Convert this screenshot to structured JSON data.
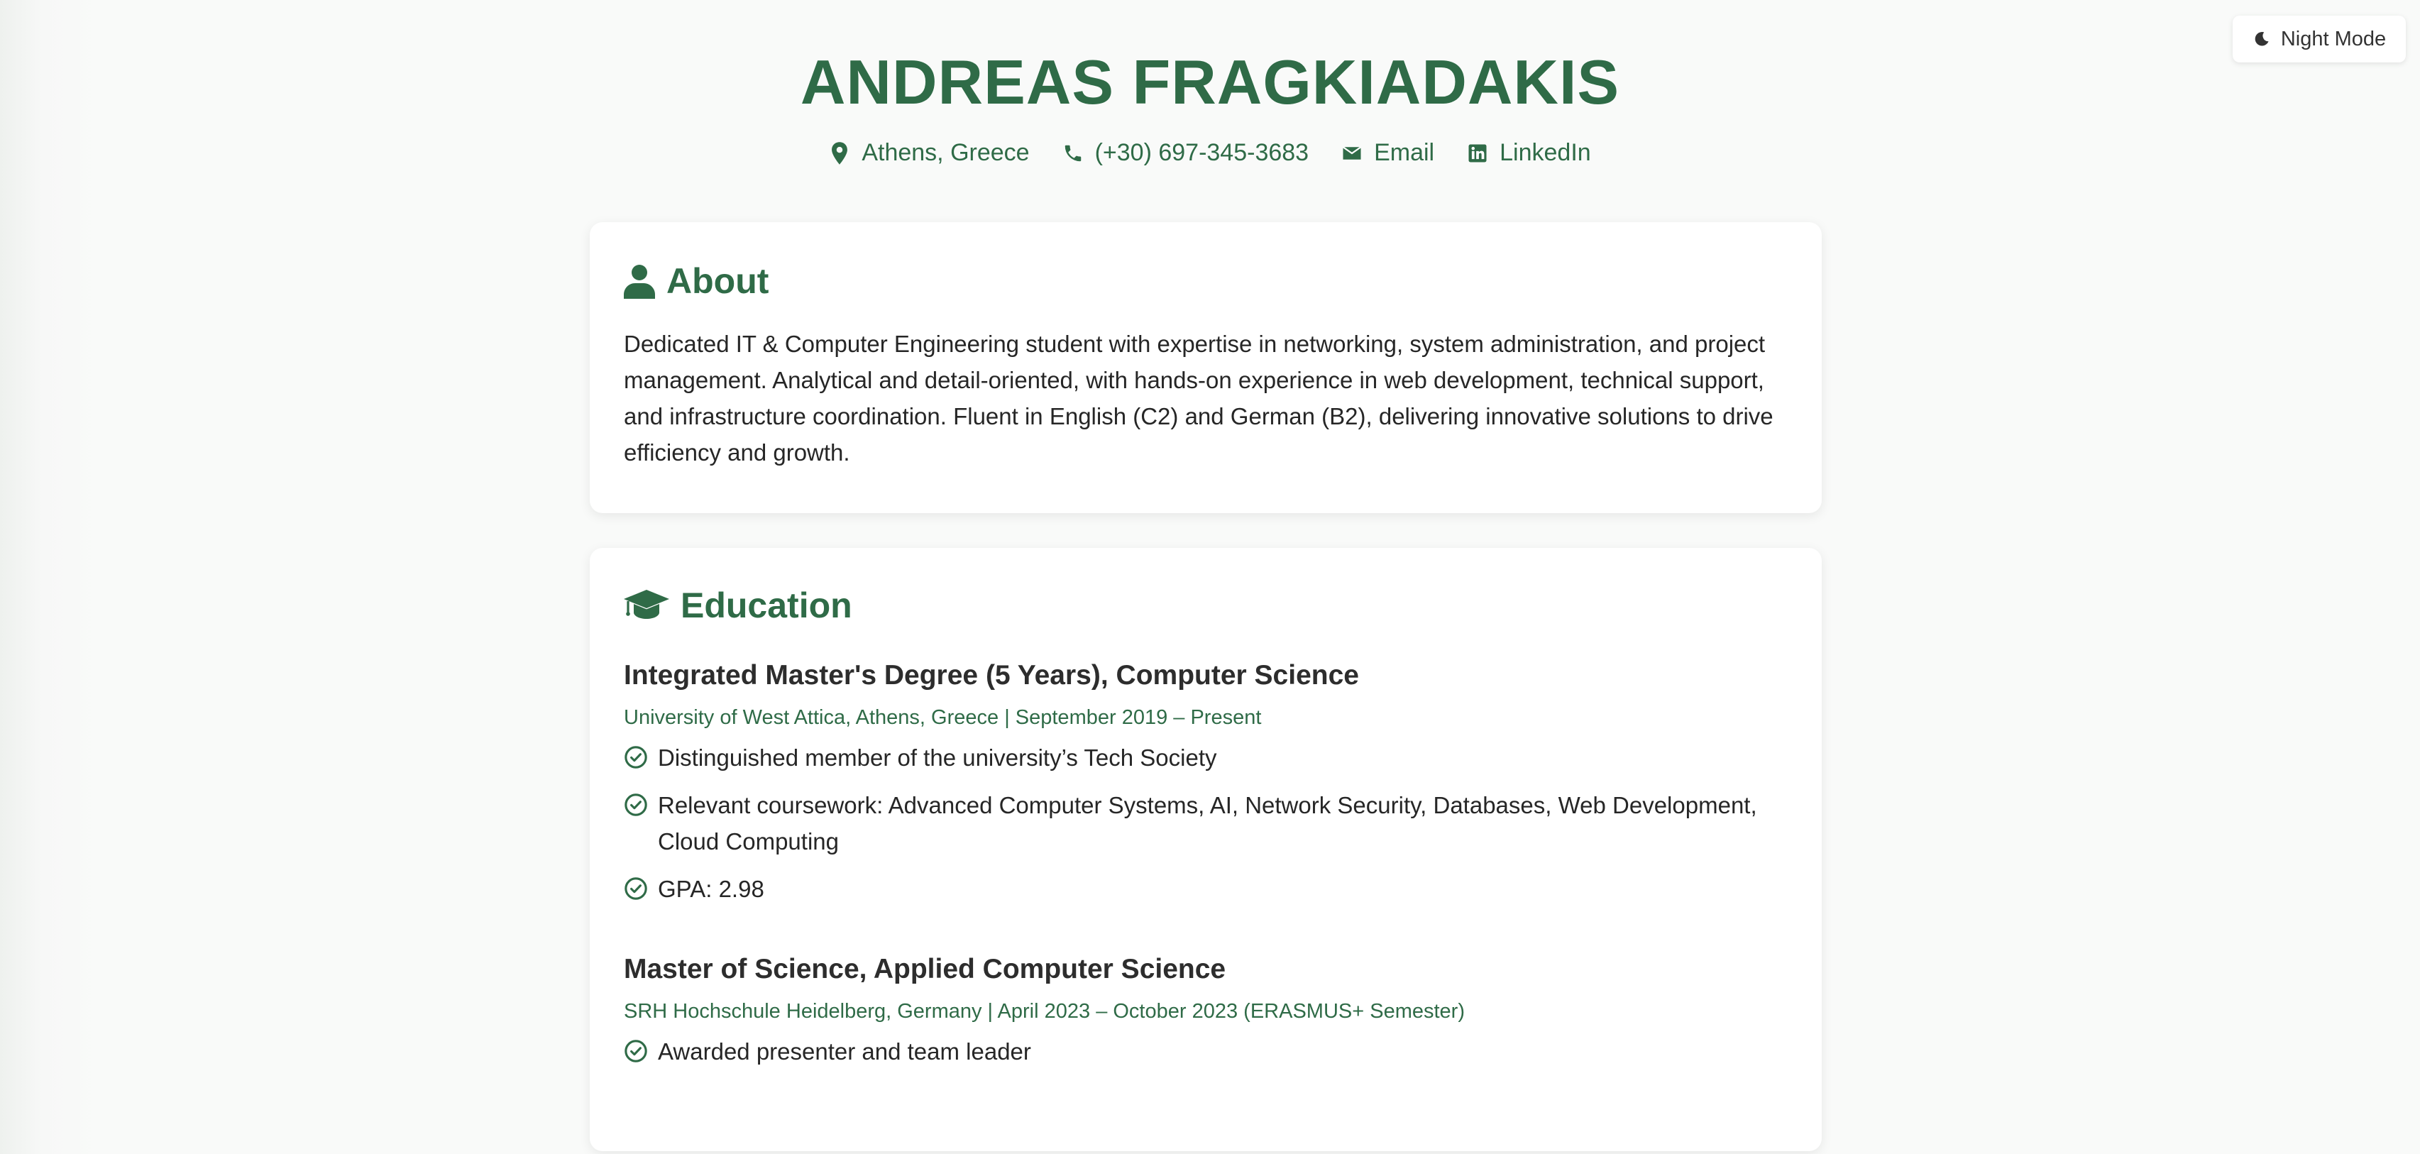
{
  "night_mode": {
    "label": "Night Mode",
    "icon": "moon-icon"
  },
  "header": {
    "name": "ANDREAS FRAGKIADAKIS",
    "contacts": [
      {
        "icon": "location-pin-icon",
        "text": "Athens, Greece"
      },
      {
        "icon": "phone-icon",
        "text": "(+30) 697-345-3683"
      },
      {
        "icon": "envelope-icon",
        "text": "Email"
      },
      {
        "icon": "linkedin-icon",
        "text": "LinkedIn"
      }
    ]
  },
  "about": {
    "title": "About",
    "icon": "user-icon",
    "text": "Dedicated IT & Computer Engineering student with expertise in networking, system administration, and project management. Analytical and detail-oriented, with hands-on experience in web development, technical support, and infrastructure coordination. Fluent in English (C2) and German (B2), delivering innovative solutions to drive efficiency and growth."
  },
  "education": {
    "title": "Education",
    "icon": "graduation-cap-icon",
    "degrees": [
      {
        "title": "Integrated Master's Degree (5 Years), Computer Science",
        "meta": "University of West Attica, Athens, Greece | September 2019 – Present",
        "bullets": [
          "Distinguished member of the university’s Tech Society",
          "Relevant coursework: Advanced Computer Systems, AI, Network Security, Databases, Web Development, Cloud Computing",
          "GPA: 2.98"
        ]
      },
      {
        "title": "Master of Science, Applied Computer Science",
        "meta": "SRH Hochschule Heidelberg, Germany | April 2023 – October 2023 (ERASMUS+ Semester)",
        "bullets": [
          "Awarded presenter and team leader"
        ]
      }
    ]
  },
  "colors": {
    "accent": "#2f6b47",
    "background": "#f9faf9",
    "card": "#ffffff",
    "text": "#262626"
  }
}
